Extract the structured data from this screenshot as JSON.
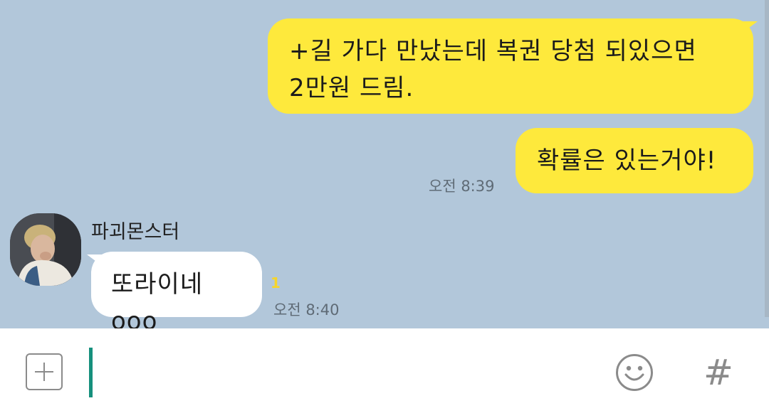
{
  "messages": {
    "sent_1_line1": "+길 가다 만났는데 복권 당첨 되있으면",
    "sent_1_line2": "2만원 드림.",
    "sent_2": "확률은 있는거야!",
    "sent_time": "오전 8:39",
    "sender_name": "파괴몬스터",
    "recv_1": "또라이네ooo",
    "recv_unread": "1",
    "recv_time": "오전 8:40"
  },
  "input": {
    "value": "",
    "plus_icon": "plus-icon",
    "emoji_icon": "smiley-icon",
    "hash_label": "#"
  },
  "colors": {
    "chat_background": "#b2c7da",
    "sent_bubble": "#fee93c",
    "received_bubble": "#ffffff",
    "unread_count": "#f6d52a",
    "cursor": "#16907d"
  }
}
